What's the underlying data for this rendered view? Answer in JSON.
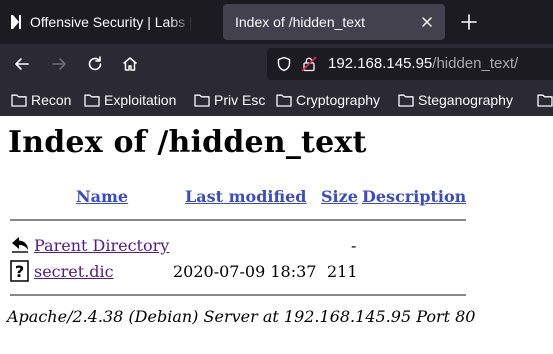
{
  "browser": {
    "tabs": [
      {
        "title": "Offensive Security | Labs |",
        "active": false
      },
      {
        "title": "Index of /hidden_text",
        "active": true
      }
    ],
    "url": {
      "host": "192.168.145.95",
      "path": "/hidden_text/"
    },
    "bookmarks": [
      "Recon",
      "Exploitation",
      "Priv Esc",
      "Cryptography",
      "Steganography"
    ]
  },
  "page": {
    "heading": "Index of /hidden_text",
    "columns": {
      "name": "Name",
      "last_modified": "Last modified",
      "size": "Size",
      "description": "Description"
    },
    "rows": [
      {
        "name": "Parent Directory",
        "last_modified": "",
        "size": "-",
        "icon": "back-icon"
      },
      {
        "name": "secret.dic",
        "last_modified": "2020-07-09 18:37",
        "size": "211",
        "icon": "unknown-file-icon"
      }
    ],
    "footer": "Apache/2.4.38 (Debian) Server at 192.168.145.95 Port 80"
  },
  "colors": {
    "tabbar": "#1c1b22",
    "toolbar": "#2b2a33",
    "active_tab": "#42414d",
    "column_link": "#3b4cc0",
    "visited_link": "#551a8b"
  }
}
